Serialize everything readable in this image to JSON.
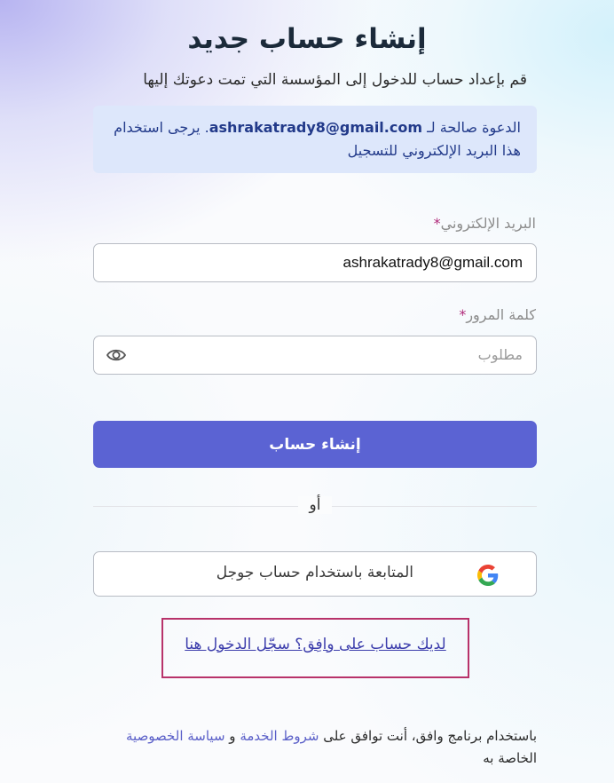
{
  "page": {
    "title": "إنشاء حساب جديد",
    "subtitle": "قم بإعداد حساب للدخول إلى المؤسسة التي تمت دعوتك إليها"
  },
  "invite": {
    "prefix": "الدعوة صالحة لـ ",
    "email": "ashrakatrady8@gmail.com",
    "suffix": ". يرجى استخدام هذا البريد الإلكتروني للتسجيل"
  },
  "email_field": {
    "label": "البريد الإلكتروني",
    "required_mark": "*",
    "value": "ashrakatrady8@gmail.com"
  },
  "password_field": {
    "label": "كلمة المرور",
    "required_mark": "*",
    "placeholder": "مطلوب",
    "toggle_icon": "eye-icon"
  },
  "create_button": {
    "label": "إنشاء حساب"
  },
  "divider": {
    "label": "أو"
  },
  "google_button": {
    "label": "المتابعة باستخدام حساب جوجل",
    "icon": "google-icon"
  },
  "login_link": {
    "label": "لديك حساب على وافِق؟ سجّل الدخول هنا"
  },
  "footer": {
    "prefix": "باستخدام برنامج وافق، أنت توافق على ",
    "terms": "شروط الخدمة",
    "conj": " و ",
    "privacy": "سياسة الخصوصية",
    "suffix": " الخاصة به"
  },
  "colors": {
    "primary": "#5b63d3",
    "invite_bg": "#dde7fb",
    "link": "#3c3dac",
    "highlight_border": "#b8326a"
  }
}
